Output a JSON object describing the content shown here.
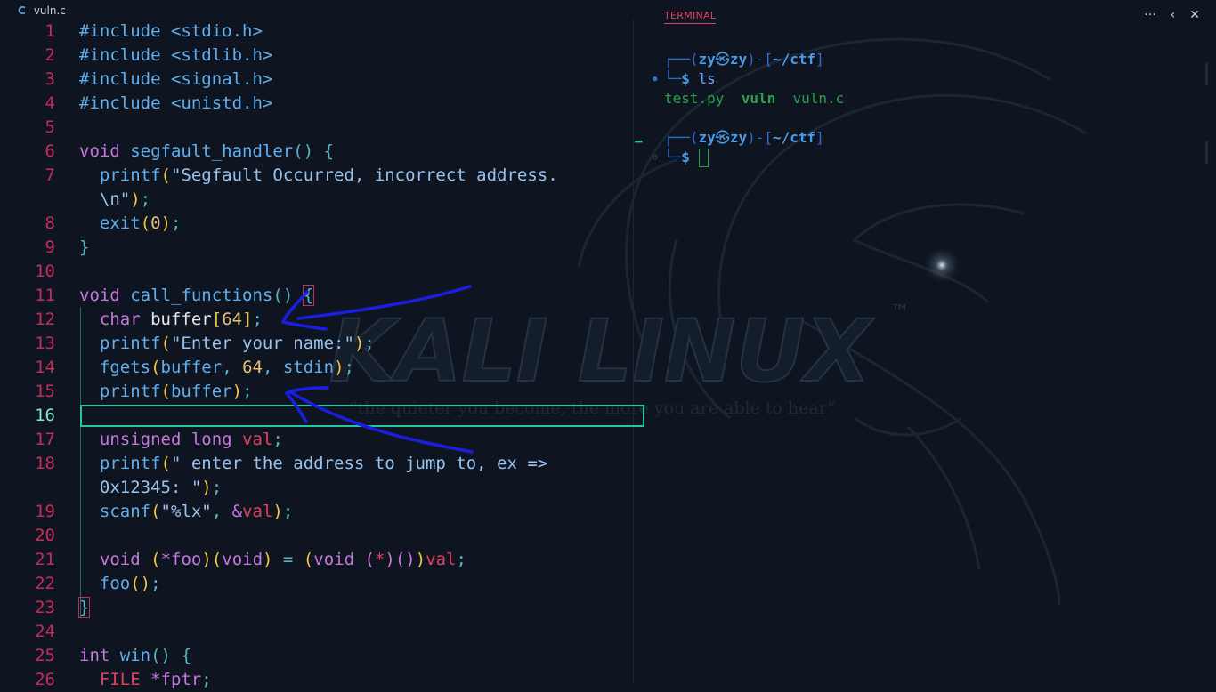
{
  "editor": {
    "tab_label": "vuln.c",
    "tab_icon": "C",
    "lines": [
      {
        "n": "1"
      },
      {
        "n": "2"
      },
      {
        "n": "3"
      },
      {
        "n": "4"
      },
      {
        "n": "5"
      },
      {
        "n": "6"
      },
      {
        "n": "7"
      },
      {
        "n": ""
      },
      {
        "n": "8"
      },
      {
        "n": "9"
      },
      {
        "n": "10"
      },
      {
        "n": "11"
      },
      {
        "n": "12"
      },
      {
        "n": "13"
      },
      {
        "n": "14"
      },
      {
        "n": "15"
      },
      {
        "n": "16"
      },
      {
        "n": "17"
      },
      {
        "n": "18"
      },
      {
        "n": ""
      },
      {
        "n": "19"
      },
      {
        "n": "20"
      },
      {
        "n": "21"
      },
      {
        "n": "22"
      },
      {
        "n": "23"
      },
      {
        "n": "24"
      },
      {
        "n": "25"
      },
      {
        "n": "26"
      }
    ],
    "code": {
      "inc1": "#include <stdio.h>",
      "inc2": "#include <stdlib.h>",
      "inc3": "#include <signal.h>",
      "inc4": "#include <unistd.h>",
      "l6_kw": "void",
      "l6_fn": "segfault_handler",
      "l6_paren": "()",
      "l6_brace": "{",
      "l7_fn": "printf",
      "l7_open": "(",
      "l7_str": "\"Segfault Occurred, incorrect address.",
      "l7b_str": "\\n\"",
      "l7b_close": ")",
      "l7b_semi": ";",
      "l8_fn": "exit",
      "l8_open": "(",
      "l8_num": "0",
      "l8_close": ")",
      "l8_semi": ";",
      "l9_brace": "}",
      "l11_kw": "void",
      "l11_fn": "call_functions",
      "l11_paren": "()",
      "l11_brace": "{",
      "l12_kw": "char",
      "l12_id": "buffer",
      "l12_ob": "[",
      "l12_num": "64",
      "l12_cb": "]",
      "l12_semi": ";",
      "l13_fn": "printf",
      "l13_open": "(",
      "l13_str": "\"Enter your name:\"",
      "l13_close": ")",
      "l13_semi": ";",
      "l14_fn": "fgets",
      "l14_open": "(",
      "l14_a": "buffer",
      "l14_c1": ", ",
      "l14_num": "64",
      "l14_c2": ", ",
      "l14_b": "stdin",
      "l14_close": ")",
      "l14_semi": ";",
      "l15_fn": "printf",
      "l15_open": "(",
      "l15_a": "buffer",
      "l15_close": ")",
      "l15_semi": ";",
      "l17_kw": "unsigned long",
      "l17_var": "val",
      "l17_semi": ";",
      "l18_fn": "printf",
      "l18_open": "(",
      "l18_str": "\" enter the address to jump to, ex =>",
      "l18b_str": "0x12345: \"",
      "l18b_close": ")",
      "l18b_semi": ";",
      "l19_fn": "scanf",
      "l19_open": "(",
      "l19_str": "\"%lx\"",
      "l19_comma": ", ",
      "l19_amp": "&",
      "l19_var": "val",
      "l19_close": ")",
      "l19_semi": ";",
      "l21_kw": "void",
      "l21_o1": "(",
      "l21_star": "*",
      "l21_foo": "foo",
      "l21_c1": ")",
      "l21_o2": "(",
      "l21_void": "void",
      "l21_c2": ")",
      "l21_eq": " = ",
      "l21_o3": "(",
      "l21_void2": "void",
      "l21_o4": "(",
      "l21_star2": "*",
      "l21_c4": ")",
      "l21_o5": "()",
      "l21_c3": ")",
      "l21_var": "val",
      "l21_semi": ";",
      "l22_fn": "foo",
      "l22_paren": "()",
      "l22_semi": ";",
      "l23_brace": "}",
      "l25_kw": "int",
      "l25_fn": "win",
      "l25_paren": "()",
      "l25_brace": "{",
      "l26_type": "FILE",
      "l26_ptr": " *fptr",
      "l26_semi": ";"
    }
  },
  "terminal": {
    "tab_label": "TERMINAL",
    "actions": {
      "more": "···",
      "back": "‹",
      "close": "✕"
    },
    "prompt1": {
      "frame_top": "┌──(",
      "user": "zy",
      "skull": "㉿",
      "host": "zy",
      "frame_mid": ")-[",
      "path": "~/ctf",
      "frame_end": "]"
    },
    "line2": {
      "frame": "└─",
      "dollar": "$",
      "cmd": " ls"
    },
    "ls_output": {
      "f1": "test.py",
      "f2": "vuln",
      "f3": "vuln.c"
    },
    "prompt2": {
      "frame_top": "┌──(",
      "user": "zy",
      "skull": "㉿",
      "host": "zy",
      "frame_mid": ")-[",
      "path": "~/ctf",
      "frame_end": "]"
    },
    "line4": {
      "frame": "└─",
      "dollar": "$"
    }
  },
  "wallpaper": {
    "brand": "KALI LINUX",
    "tm": "™",
    "tagline": "“the quieter you become, the more you are able to hear”"
  },
  "colors": {
    "background": "#0e1520",
    "line_number": "#c22d5b",
    "active_line_number": "#7fe8d2",
    "keyword": "#c678dd",
    "function": "#61afef",
    "annotation_ink": "#1a1ee0",
    "cursor_line_border": "#27c4a3"
  }
}
